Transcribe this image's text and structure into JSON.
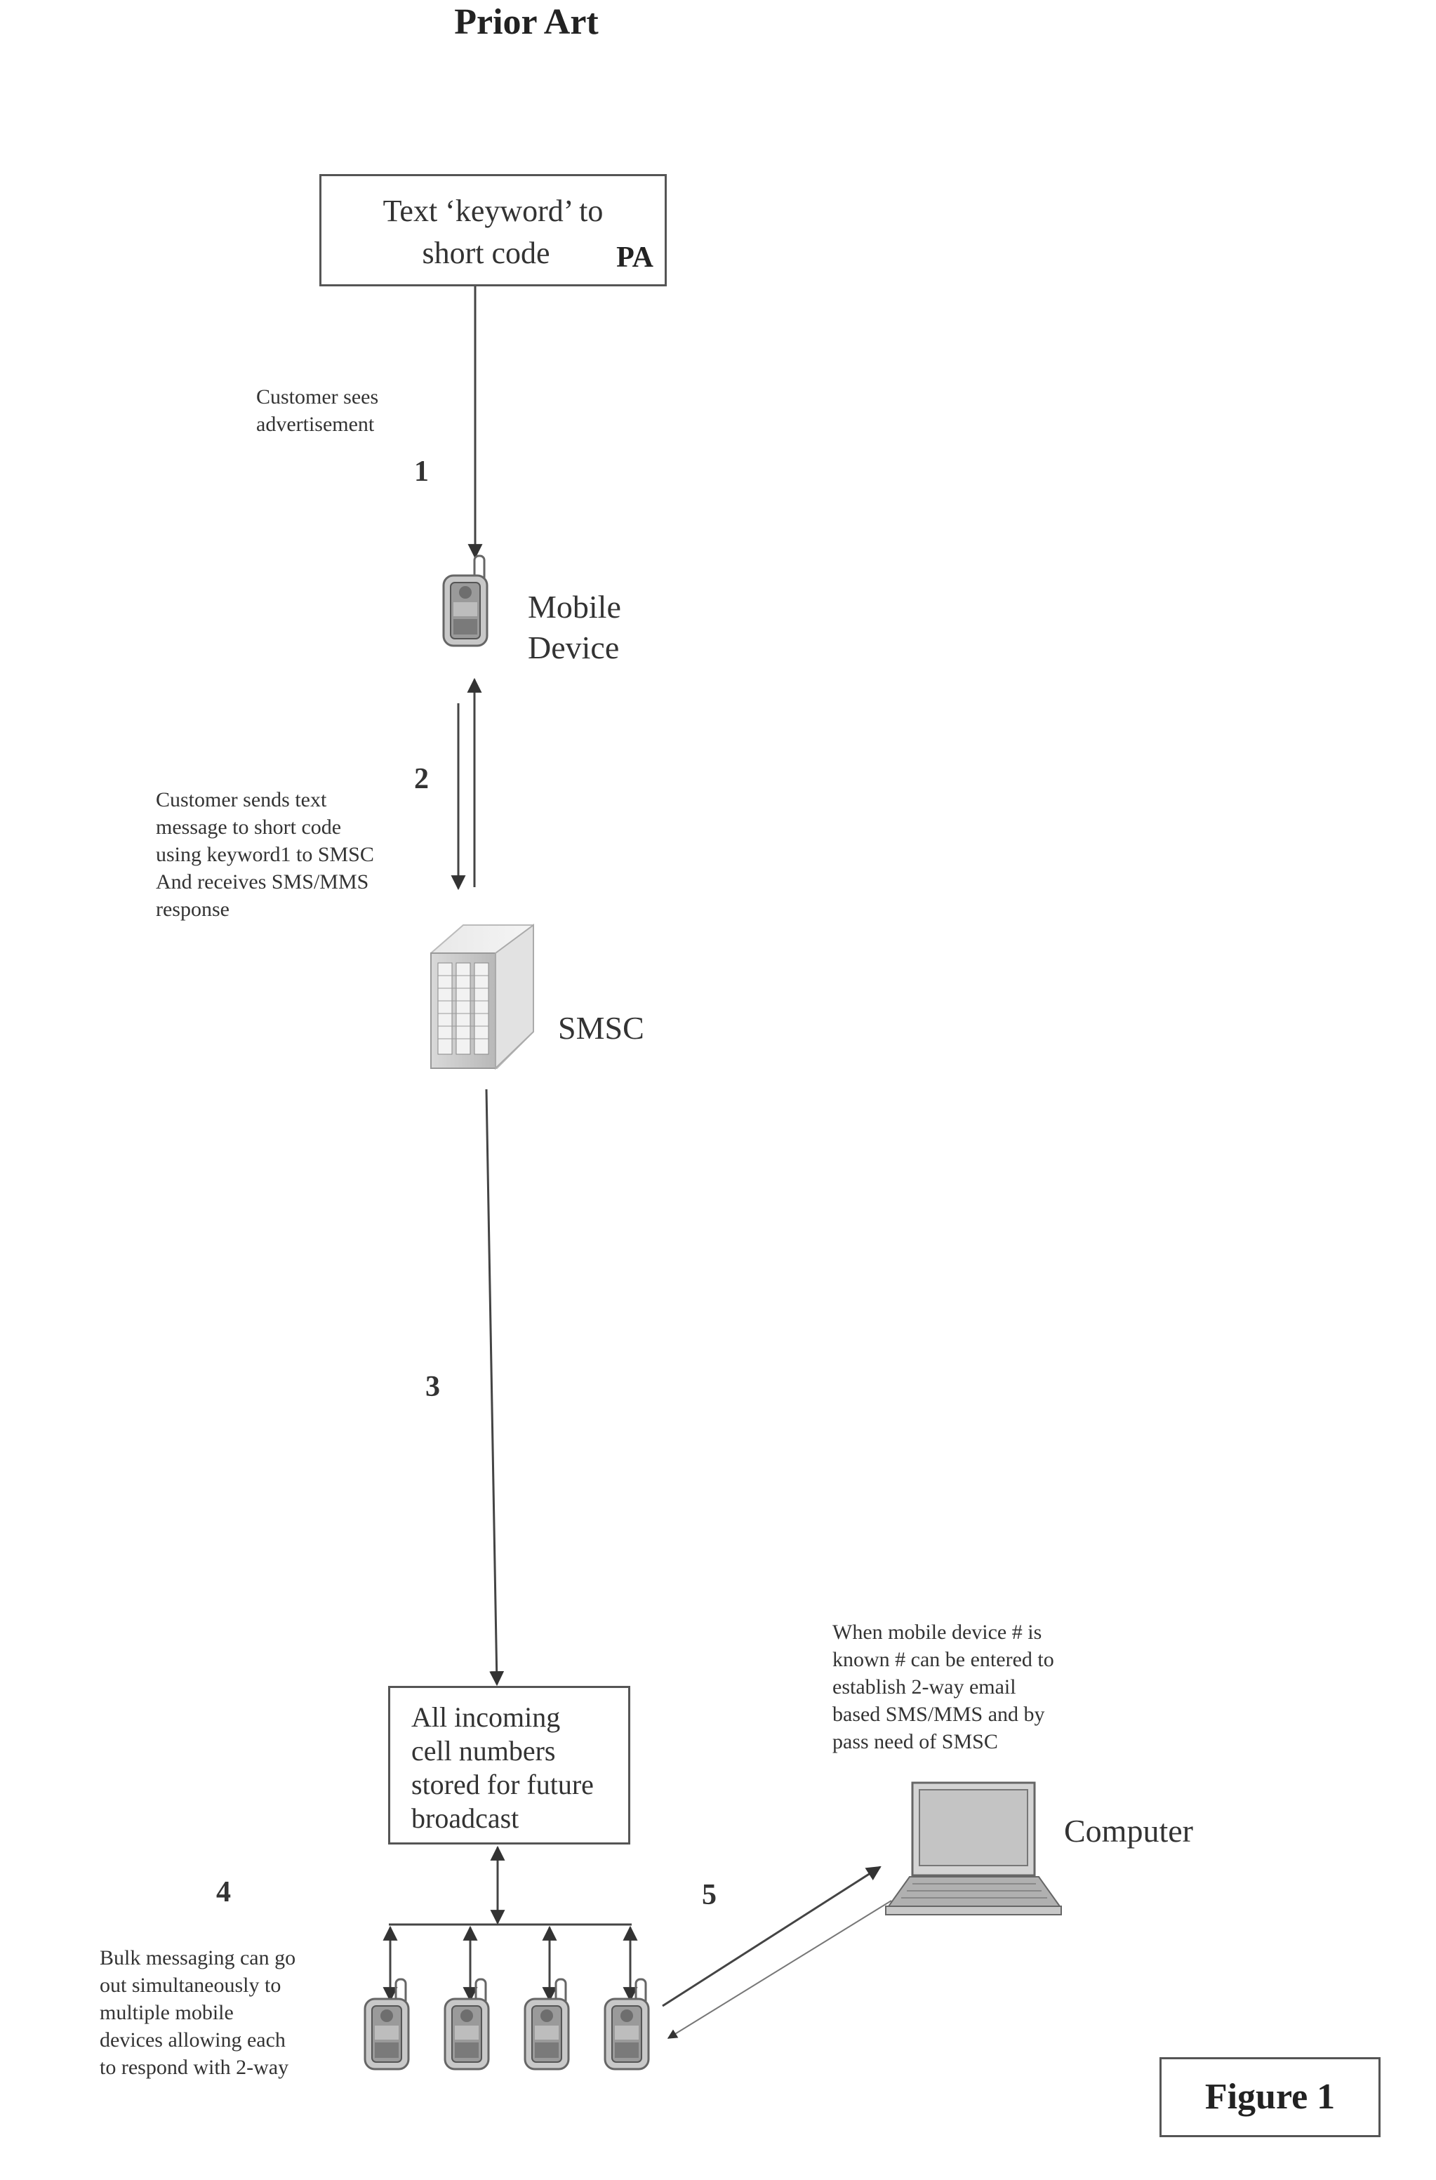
{
  "figure": {
    "heading": "Prior Art",
    "caption": "Figure 1"
  },
  "nodes": {
    "start_box": {
      "lines": [
        "Text ‘keyword’ to",
        "short code"
      ],
      "tag": "PA"
    },
    "mobile_device": {
      "lines": [
        "Mobile",
        "Device"
      ],
      "icon": "mobile-phone-icon"
    },
    "smsc": {
      "label": "SMSC",
      "icon": "server-tower-icon"
    },
    "store_box": {
      "lines": [
        "All incoming",
        "cell numbers",
        "stored for future",
        "broadcast"
      ]
    },
    "computer": {
      "label": "Computer",
      "icon": "laptop-icon"
    },
    "bulk_devices": {
      "count": 4,
      "icon": "mobile-phone-icon"
    }
  },
  "steps": [
    {
      "number": "1",
      "note": [
        "Customer sees",
        "advertisement"
      ]
    },
    {
      "number": "2",
      "note": [
        "Customer sends text",
        "message to short code",
        "using keyword1 to SMSC",
        "And receives SMS/MMS",
        "response"
      ]
    },
    {
      "number": "3",
      "note": []
    },
    {
      "number": "4",
      "note": [
        "Bulk messaging can go",
        "out simultaneously to",
        "multiple mobile",
        "devices allowing each",
        "to respond with 2-way"
      ]
    },
    {
      "number": "5",
      "note": [
        "When mobile device # is",
        "known # can be entered to",
        "establish 2-way email",
        "based SMS/MMS and by",
        "pass need of SMSC"
      ]
    }
  ],
  "colors": {
    "line": "#444444",
    "device_fill": "#bdbdbd",
    "device_dark": "#6e6e6e",
    "text": "#333333"
  }
}
